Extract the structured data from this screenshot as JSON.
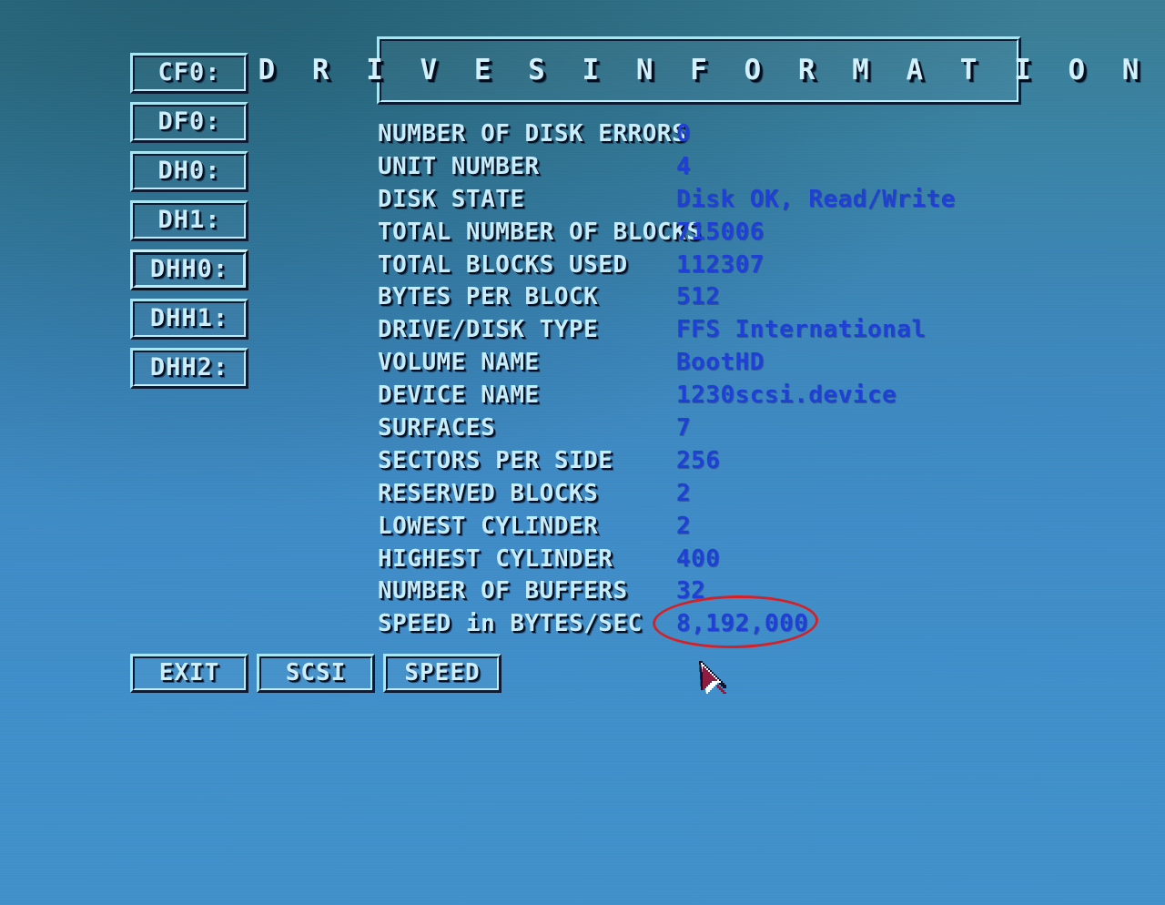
{
  "window": {
    "title": "D R I V E S   I N F O R M A T I O N"
  },
  "drive_list": {
    "items": [
      {
        "label": "CF0:",
        "selected": false
      },
      {
        "label": "DF0:",
        "selected": false
      },
      {
        "label": "DH0:",
        "selected": false
      },
      {
        "label": "DH1:",
        "selected": false
      },
      {
        "label": "DHH0:",
        "selected": true
      },
      {
        "label": "DHH1:",
        "selected": false
      },
      {
        "label": "DHH2:",
        "selected": false
      }
    ]
  },
  "info": {
    "rows": [
      {
        "label": "NUMBER OF DISK ERRORS",
        "value": "0"
      },
      {
        "label": "UNIT NUMBER",
        "value": "4"
      },
      {
        "label": "DISK STATE",
        "value": "Disk OK, Read/Write"
      },
      {
        "label": "TOTAL NUMBER OF BLOCKS",
        "value": "715006"
      },
      {
        "label": "TOTAL BLOCKS USED",
        "value": "112307"
      },
      {
        "label": "BYTES PER BLOCK",
        "value": "512"
      },
      {
        "label": "DRIVE/DISK TYPE",
        "value": "FFS International"
      },
      {
        "label": "VOLUME NAME",
        "value": "BootHD"
      },
      {
        "label": "DEVICE NAME",
        "value": "1230scsi.device"
      },
      {
        "label": "SURFACES",
        "value": "7"
      },
      {
        "label": "SECTORS PER SIDE",
        "value": "256"
      },
      {
        "label": "RESERVED BLOCKS",
        "value": "2"
      },
      {
        "label": "LOWEST CYLINDER",
        "value": "2"
      },
      {
        "label": "HIGHEST CYLINDER",
        "value": "400"
      },
      {
        "label": "NUMBER OF BUFFERS",
        "value": "32"
      },
      {
        "label": "SPEED in BYTES/SEC",
        "value": "8,192,000"
      }
    ]
  },
  "actions": {
    "exit_label": "EXIT",
    "scsi_label": "SCSI",
    "speed_label": "SPEED"
  },
  "annotation": {
    "shape": "ellipse",
    "target": "SPEED in BYTES/SEC",
    "color": "#d52027"
  },
  "cursor": {
    "icon": "arrow-pointer",
    "fill": "#8e1b3f",
    "highlight": "#ffffff",
    "outline": "#10102a"
  },
  "theme": {
    "background_top": "#3a7e95",
    "background_bottom": "#4191cc",
    "label_color": "#c9edfa",
    "value_color": "#1f3fd6",
    "bevel_light": "#a9e7f5",
    "bevel_dark": "#0b1a33"
  }
}
